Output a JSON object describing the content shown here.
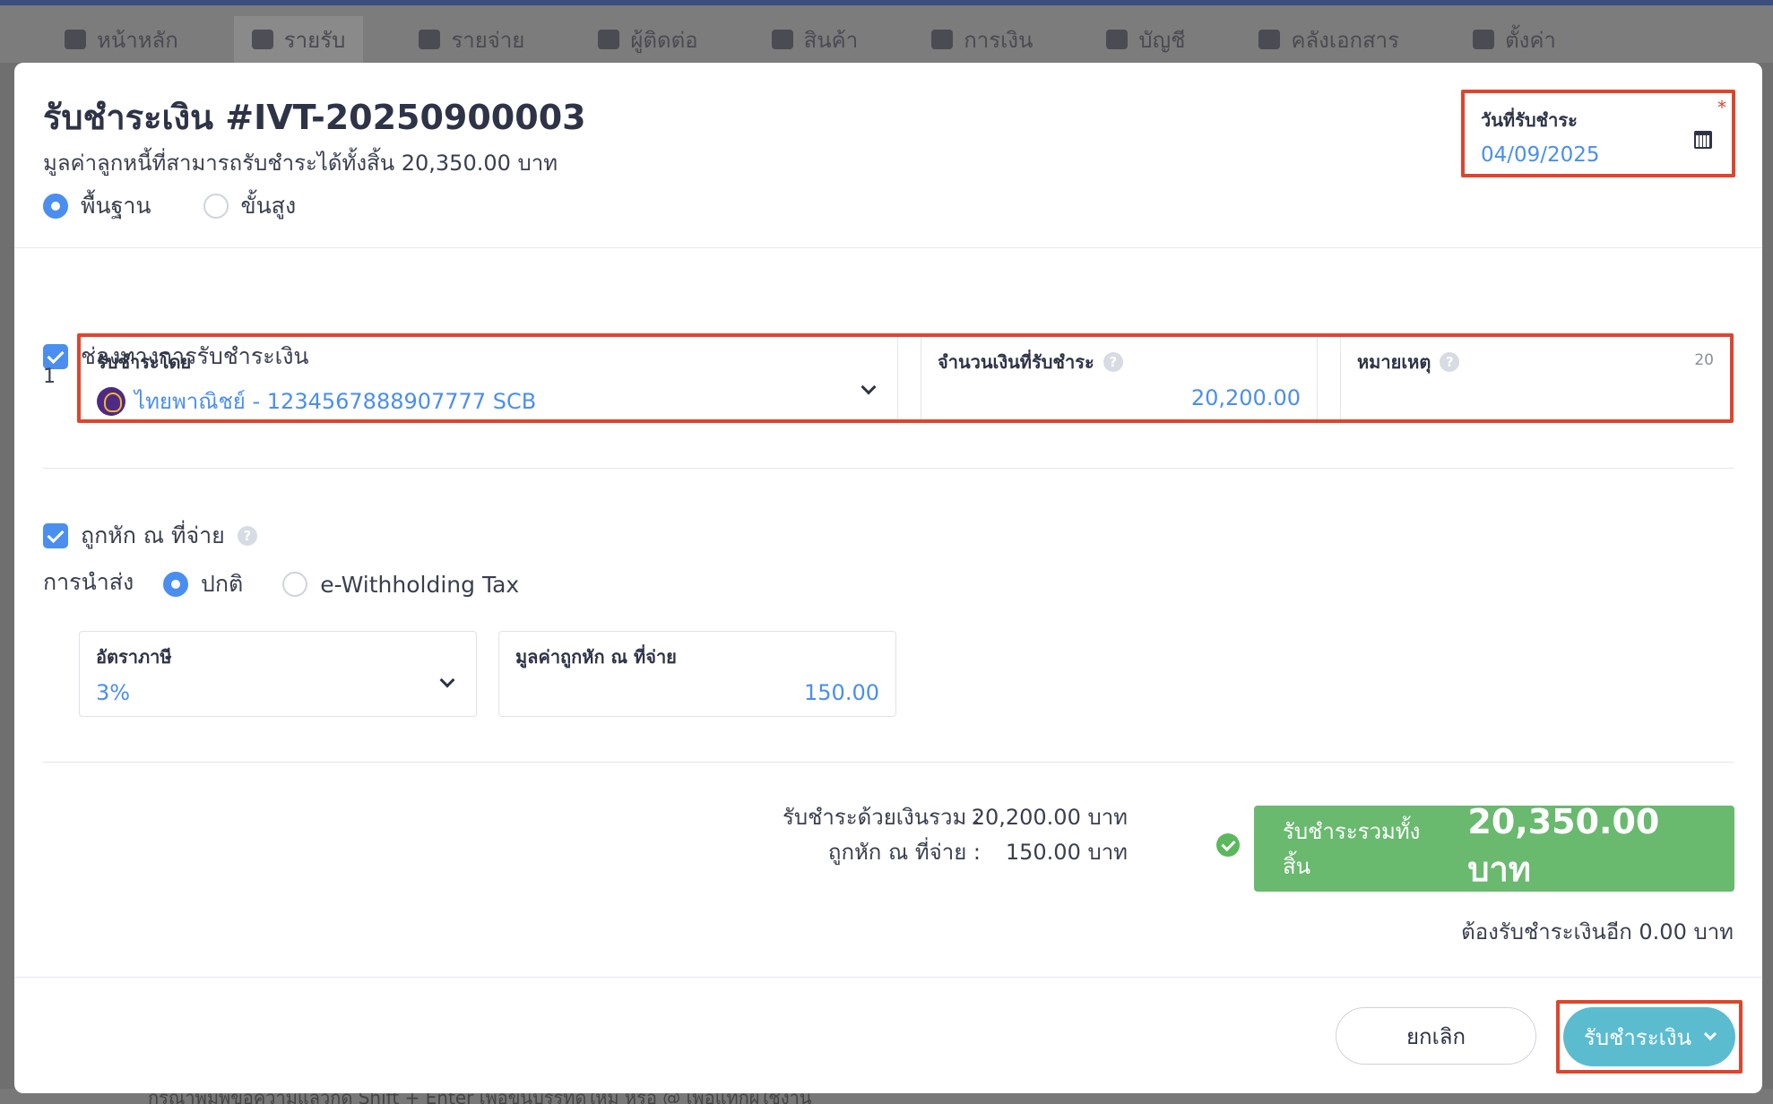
{
  "background": {
    "nav": [
      "หน้าหลัก",
      "รายรับ",
      "รายจ่าย",
      "ผู้ติดต่อ",
      "สินค้า",
      "การเงิน",
      "บัญชี",
      "คลังเอกสาร",
      "ตั้งค่า"
    ],
    "footer_hint": "กรุณาพิมพ์ข้อความแล้วกด Shift + Enter เพื่อขึ้นบรรทัดใหม่ หรือ @ เพื่อแท็กผู้ใช้งาน"
  },
  "modal": {
    "title": "รับชำระเงิน #IVT-20250900003",
    "subtitle": "มูลค่าลูกหนี้ที่สามารถรับชำระได้ทั้งสิ้น 20,350.00 บาท",
    "modes": [
      "พื้นฐาน",
      "ขั้นสูง"
    ],
    "selected_mode": "พื้นฐาน",
    "date_label": "วันที่รับชำระ",
    "date_value": "04/09/2025",
    "required_mark": "*"
  },
  "payment_channel": {
    "label": "ช่องทางการรับชำระเงิน",
    "row_number": "1",
    "received_by_label": "รับชำระโดย",
    "received_by_value": "ไทยพาณิชย์ - 1234567888907777 SCB",
    "amount_label": "จำนวนเงินที่รับชำระ",
    "amount_value": "20,200.00",
    "note_label": "หมายเหตุ",
    "note_counter": "20"
  },
  "withholding": {
    "label": "ถูกหัก ณ ที่จ่าย",
    "submit_label": "การนำส่ง",
    "options": [
      "ปกติ",
      "e-Withholding Tax"
    ],
    "selected_option": "ปกติ",
    "tax_rate_label": "อัตราภาษี",
    "tax_rate_value": "3%",
    "amount_label": "มูลค่าถูกหัก ณ ที่จ่าย",
    "amount_value": "150.00"
  },
  "summary": {
    "paid_total_label": "รับชำระด้วยเงินรวม :",
    "paid_total_value": "20,200.00 บาท",
    "withheld_label": "ถูกหัก ณ ที่จ่าย :",
    "withheld_value": "150.00 บาท",
    "grand_total_label": "รับชำระรวมทั้งสิ้น",
    "grand_total_value": "20,350.00 บาท",
    "remaining": "ต้องรับชำระเงินอีก 0.00 บาท"
  },
  "footer": {
    "cancel_label": "ยกเลิก",
    "submit_label": "รับชำระเงิน"
  },
  "help_glyph": "?",
  "colors": {
    "accent": "#4a8ef0",
    "highlight": "#e0442c",
    "total_bg": "#69b96f",
    "submit_bg": "#5bbcd0"
  }
}
